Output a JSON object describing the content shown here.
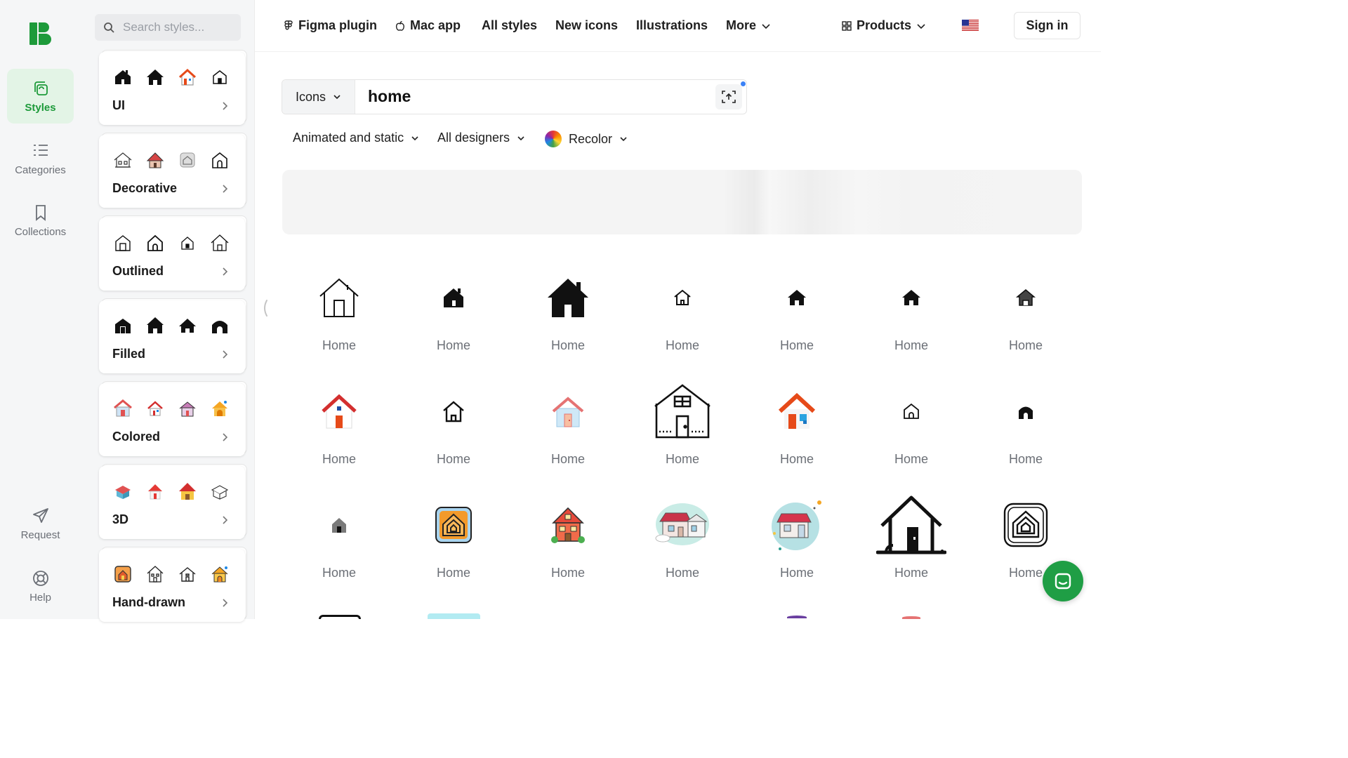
{
  "rail": {
    "items": [
      {
        "label": "Styles",
        "icon": "styles-icon",
        "active": true
      },
      {
        "label": "Categories",
        "icon": "list-icon"
      },
      {
        "label": "Collections",
        "icon": "bookmark-icon"
      },
      {
        "label": "Request",
        "icon": "paper-plane-icon"
      },
      {
        "label": "Help",
        "icon": "lifebuoy-icon"
      }
    ]
  },
  "styles_panel": {
    "search_placeholder": "Search styles...",
    "cards": [
      {
        "label": "UI"
      },
      {
        "label": "Decorative"
      },
      {
        "label": "Outlined"
      },
      {
        "label": "Filled"
      },
      {
        "label": "Colored"
      },
      {
        "label": "3D"
      },
      {
        "label": "Hand-drawn"
      }
    ]
  },
  "nav": {
    "figma": "Figma plugin",
    "mac": "Mac app",
    "all_styles": "All styles",
    "new_icons": "New icons",
    "illustrations": "Illustrations",
    "more": "More",
    "products": "Products",
    "sign_in": "Sign in"
  },
  "search": {
    "type": "Icons",
    "query": "home"
  },
  "filters": {
    "animation": "Animated and static",
    "designers": "All designers",
    "recolor": "Recolor"
  },
  "results": [
    {
      "label": "Home"
    },
    {
      "label": "Home"
    },
    {
      "label": "Home"
    },
    {
      "label": "Home"
    },
    {
      "label": "Home"
    },
    {
      "label": "Home"
    },
    {
      "label": "Home"
    },
    {
      "label": "Home"
    },
    {
      "label": "Home"
    },
    {
      "label": "Home"
    },
    {
      "label": "Home"
    },
    {
      "label": "Home"
    },
    {
      "label": "Home"
    },
    {
      "label": "Home"
    },
    {
      "label": "Home"
    },
    {
      "label": "Home"
    },
    {
      "label": "Home"
    },
    {
      "label": "Home"
    },
    {
      "label": "Home"
    },
    {
      "label": "Home"
    },
    {
      "label": "Home"
    }
  ],
  "colors": {
    "brand_green": "#1d9a3a",
    "active_bg": "#e3f4e6",
    "chat_button": "#1f9e45"
  }
}
